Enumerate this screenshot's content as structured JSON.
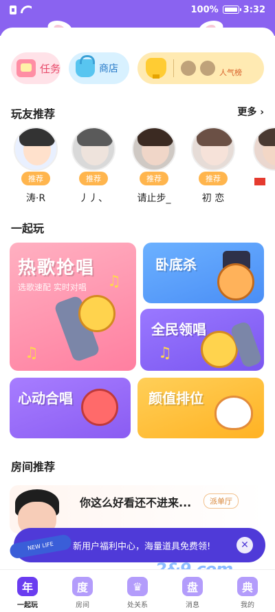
{
  "status_bar": {
    "battery": "100%",
    "time": "3:32"
  },
  "pills": {
    "task": "任务",
    "shop": "商店",
    "rank": "人气榜"
  },
  "friends_section": {
    "title": "玩友推荐",
    "more": "更多 ›"
  },
  "friends": [
    {
      "name": "涛·R",
      "tag": "推荐"
    },
    {
      "name": "丿丿、",
      "tag": "推荐"
    },
    {
      "name": "请止步_",
      "tag": "推荐"
    },
    {
      "name": "初 恋",
      "tag": "推荐"
    }
  ],
  "play_section": {
    "title": "一起玩"
  },
  "cards": {
    "hot": {
      "title": "热歌抢唱",
      "subtitle": "选歌速配 实时对唱"
    },
    "spy": {
      "title": "卧底杀"
    },
    "lead": {
      "title": "全民领唱"
    },
    "heart": {
      "title": "心动合唱"
    },
    "face": {
      "title": "颜值排位"
    }
  },
  "room_section": {
    "title": "房间推荐"
  },
  "room": {
    "title": "你这么好看还不进来...",
    "badge": "派单厅",
    "ribbon": "NEW LIFE"
  },
  "banner": {
    "text": "新用户福利中心，海量道具免费领!",
    "close": "✕"
  },
  "watermark": "2&9.com",
  "nav": [
    {
      "icon": "年",
      "label": "一起玩",
      "active": true
    },
    {
      "icon": "度",
      "label": "房间",
      "active": false
    },
    {
      "icon": "♛",
      "label": "处关系",
      "active": false
    },
    {
      "icon": "盘",
      "label": "消息",
      "active": false
    },
    {
      "icon": "典",
      "label": "我的",
      "active": false
    }
  ]
}
